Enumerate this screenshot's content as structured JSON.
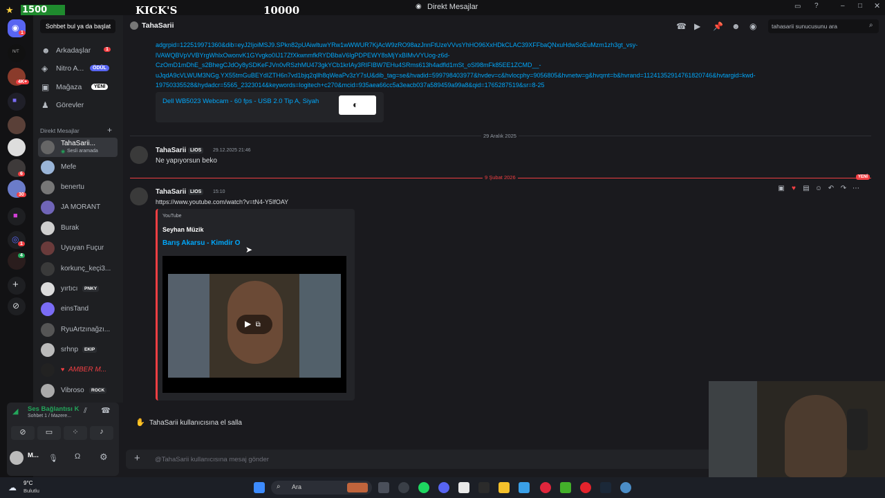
{
  "window": {
    "title": "Direkt Mesajlar"
  },
  "stream_overlay": {
    "points": "1500",
    "brand": "KICK'S",
    "goal": "10000"
  },
  "sidebar": {
    "search_button": "Sohbet bul ya da başlat",
    "nav": [
      {
        "label": "Arkadaşlar",
        "icon": "friends-icon",
        "badge": "1"
      },
      {
        "label": "Nitro A...",
        "icon": "nitro-icon",
        "pill": "ÖDÜL"
      },
      {
        "label": "Mağaza",
        "icon": "shop-icon",
        "pill": "YENİ"
      },
      {
        "label": "Görevler",
        "icon": "quests-icon"
      }
    ],
    "dm_section_title": "Direkt Mesajlar",
    "dms": [
      {
        "name": "TahaSarii...",
        "status": "Sesli aramada",
        "active": true
      },
      {
        "name": "Mefe"
      },
      {
        "name": "benertu"
      },
      {
        "name": "JA MORANT"
      },
      {
        "name": "Burak"
      },
      {
        "name": "Uyuyan Fuçur"
      },
      {
        "name": "korkunç_keçi3..."
      },
      {
        "name": "yırtıcı",
        "tag": "PNKY"
      },
      {
        "name": "einsTand"
      },
      {
        "name": "RyuArtzınağzı..."
      },
      {
        "name": "srhnp",
        "tag": "EKIP"
      },
      {
        "name": "AMBER M..."
      },
      {
        "name": "Vibroso",
        "tag": "ROCK"
      }
    ]
  },
  "voice_panel": {
    "status": "Ses Bağlantısı K",
    "channel": "Sohbet 1 / Mazere...",
    "user": "M..."
  },
  "header": {
    "channel_name": "TahaSarii",
    "search_placeholder": "tahasarii sunucusunu ara"
  },
  "messages": {
    "url_lines": [
      "adgrpid=122519971360&dib=eyJ2IjoiMSJ9.SPkn82pUAiwltuwYRw1wWWUR7KjAcW9zRO98azJnnFtUzeVVvsYhHO96XxHDkCLAC39XFFbaQNxuHdwSoEuMzm1zh3gt_vsy-",
      "lVAWQBVpVVBYrgWhlxOwonvK1GYvgko0IJ17ZfXkwnmfkRYDBbaV6lgPDPEWY8sMjYxBIMvVYUog-z6d-",
      "CzOmD1mDhE_s2BhegCJdOy8ySDKeFJVn0vRSzhMU473gkYCb1krIAy3RIFIBW7EHu4SRms613h4adfld1mSt_oSl98mFk85EE1ZCMD__-",
      "uJqdA9cVLWUM3NGg.YX55tmGuBEYdIZTH6n7vd1bjq2qllh8qWeaPv3zY7sU&dib_tag=se&hvadid=599798403977&hvdev=c&hvlocphy=9056805&hvnetw=g&hvqmt=b&hvrand=11241352914761820746&hvtargid=kwd-",
      "19750335528&hydadcr=5565_2323014&keywords=logitech+c270&mcid=935aea66cc5a3eacb037a589459a99a8&qid=1765287519&sr=8-25"
    ],
    "product_embed_title": "Dell WB5023 Webcam - 60 fps - USB 2.0 Tip A, Siyah",
    "date_divider_1": "29 Aralık 2025",
    "msg1": {
      "author": "TahaSarii",
      "clan": "LIOS",
      "time": "29.12.2025 21:46",
      "text": "Ne yapıyorsun beko"
    },
    "date_divider_2": "9 Şubat 2026",
    "new_badge": "YENİ",
    "msg2": {
      "author": "TahaSarii",
      "clan": "LIOS",
      "time": "15:10",
      "link": "https://www.youtube.com/watch?v=tN4-Y5IfOAY",
      "embed": {
        "provider": "YouTube",
        "author": "Seyhan Müzik",
        "title": "Barış Akarsu - Kimdir O"
      }
    },
    "wave_prompt": "TahaSarii kullanıcısına el salla"
  },
  "composer": {
    "placeholder": "@TahaSarii kullanıcısına mesaj gönder"
  },
  "taskbar": {
    "weather_temp": "9°C",
    "weather_desc": "Bulutlu",
    "search": "Ara"
  },
  "colors": {
    "accent": "#5865f2",
    "link": "#00a8fc",
    "danger": "#f23f43",
    "bg": "#1a1a1e"
  }
}
